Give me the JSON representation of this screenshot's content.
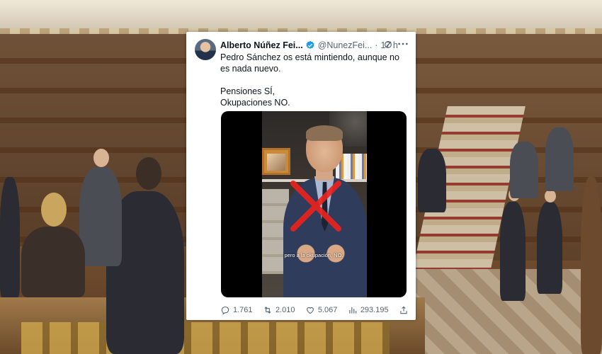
{
  "tweet": {
    "author_name": "Alberto Núñez Fei...",
    "author_handle": "@NunezFei...",
    "separator": "·",
    "time": "17 h",
    "text_line1": "Pedro Sánchez os está mintiendo, aunque no es nada nuevo.",
    "text_line2": "Pensiones SÍ,",
    "text_line3": "Okupaciones NO.",
    "video_caption": "pero a la okupación, NO.",
    "replies": "1.761",
    "retweets": "2.010",
    "likes": "5.067",
    "views": "293.195"
  },
  "icons": {
    "verified": "verified-badge-icon",
    "grok": "grok-icon",
    "more": "more-options-icon",
    "reply": "reply-icon",
    "retweet": "retweet-icon",
    "like": "like-icon",
    "views": "views-icon",
    "share": "share-icon"
  },
  "colors": {
    "verified_blue": "#1d9bf0",
    "meta_grey": "#536471",
    "cross_red": "#e8231e"
  }
}
